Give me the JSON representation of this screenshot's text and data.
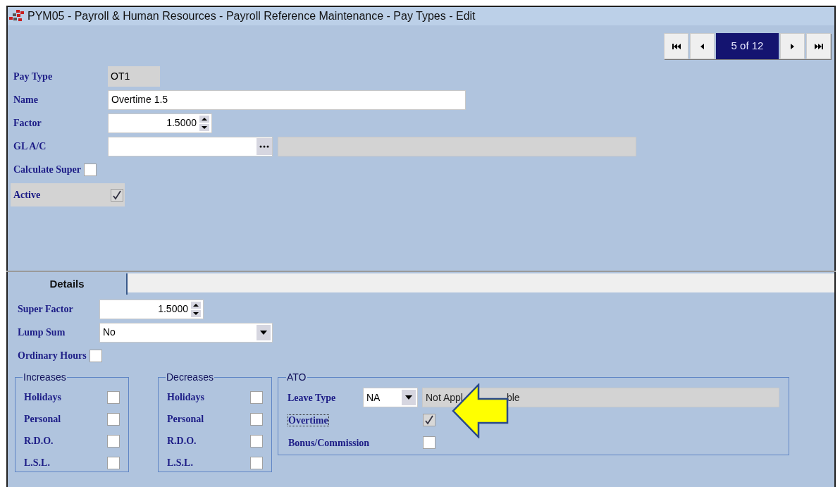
{
  "window": {
    "title": "PYM05 - Payroll & Human Resources - Payroll Reference Maintenance - Pay Types - Edit"
  },
  "navigator": {
    "position": "5 of 12"
  },
  "fields": [
    {
      "label": "Pay Type",
      "kind": "readonly",
      "value": "OT1",
      "highlighted": false
    },
    {
      "label": "Name",
      "kind": "text",
      "value": "Overtime 1.5",
      "highlighted": false
    },
    {
      "label": "Factor",
      "kind": "spin",
      "value": "1.5000",
      "highlighted": false
    },
    {
      "label": "GL A/C",
      "kind": "lookup",
      "highlighted": false
    },
    {
      "label": "Calculate Super",
      "kind": "checkbox",
      "checked": false,
      "highlighted": false
    },
    {
      "label": "Active",
      "kind": "checkbox",
      "checked": true,
      "highlighted": true
    }
  ],
  "tabs": [
    {
      "label": "Details",
      "selected": true
    }
  ],
  "details": [
    {
      "label": "Super Factor",
      "kind": "spin",
      "value": "1.5000"
    },
    {
      "label": "Lump Sum",
      "kind": "select",
      "value": "No"
    },
    {
      "label": "Ordinary Hours",
      "kind": "checkbox",
      "checked": false
    }
  ],
  "groups": [
    {
      "title": "Increases",
      "items": [
        {
          "label": "Holidays",
          "checked": false
        },
        {
          "label": "Personal",
          "checked": false
        },
        {
          "label": "R.D.O.",
          "checked": false
        },
        {
          "label": "L.S.L.",
          "checked": false
        }
      ]
    },
    {
      "title": "Decreases",
      "items": [
        {
          "label": "Holidays",
          "checked": false
        },
        {
          "label": "Personal",
          "checked": false
        },
        {
          "label": "R.D.O.",
          "checked": false
        },
        {
          "label": "L.S.L.",
          "checked": false
        }
      ]
    }
  ],
  "ato": {
    "title": "ATO",
    "leave_type": {
      "label": "Leave Type",
      "value": "NA",
      "description_parts": [
        "Not Appl",
        "ble"
      ]
    },
    "items": [
      {
        "label": "Overtime",
        "checked": true,
        "focused": true
      },
      {
        "label": "Bonus/Commission",
        "checked": false,
        "focused": false
      }
    ]
  }
}
